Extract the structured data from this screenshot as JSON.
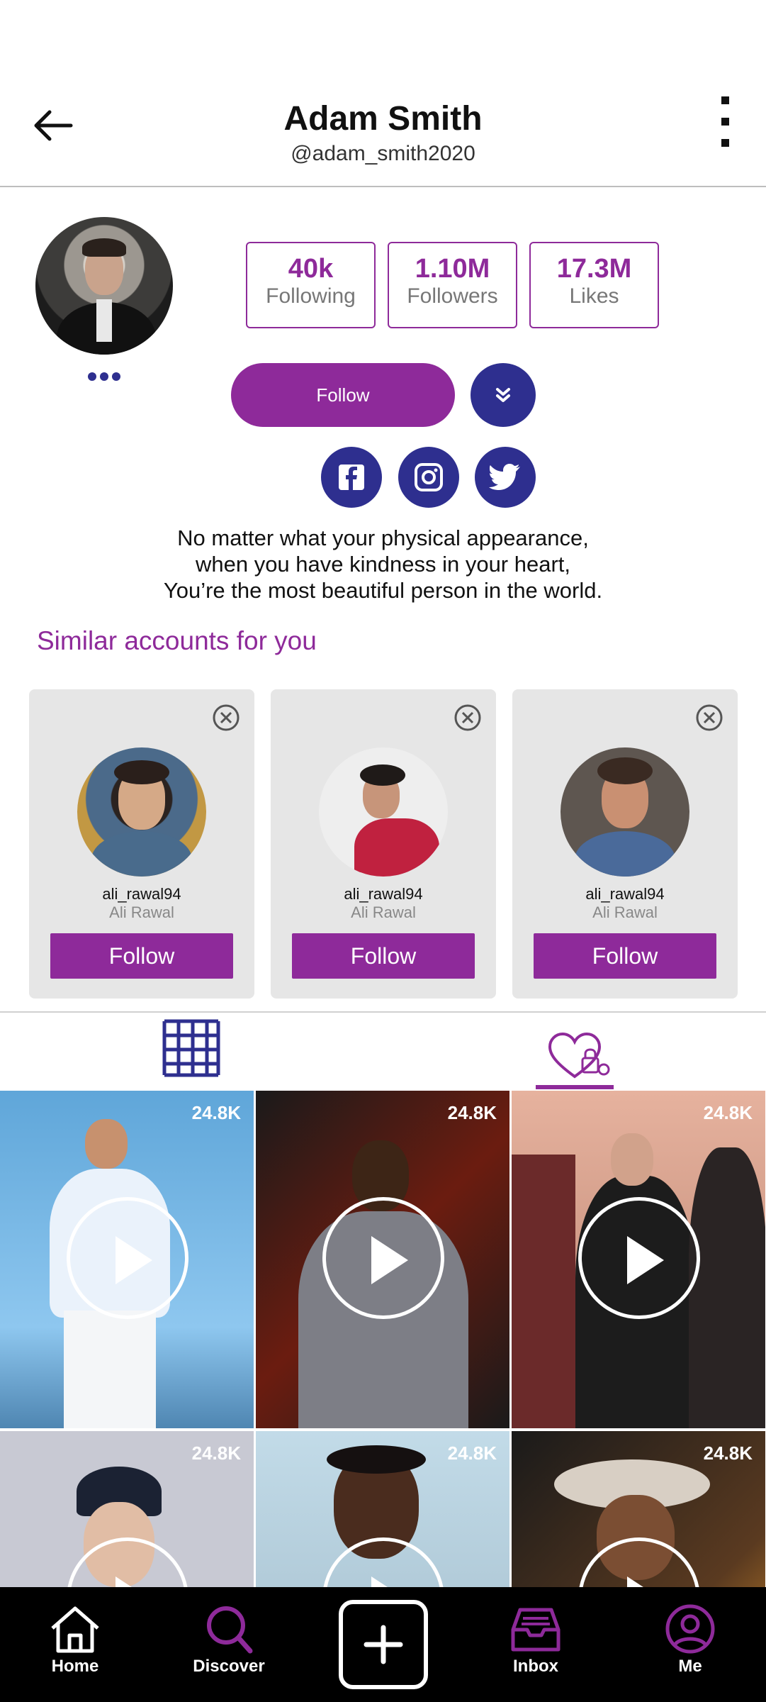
{
  "header": {
    "title": "Adam Smith",
    "handle": "@adam_smith2020"
  },
  "stats": [
    {
      "value": "40k",
      "label": "Following"
    },
    {
      "value": "1.10M",
      "label": "Followers"
    },
    {
      "value": "17.3M",
      "label": "Likes"
    }
  ],
  "actions": {
    "follow_label": "Follow"
  },
  "social": [
    "facebook-icon",
    "instagram-icon",
    "twitter-icon"
  ],
  "bio": [
    "No matter what your physical appearance,",
    "when you have kindness in your heart,",
    "You’re the most beautiful person in the world."
  ],
  "similar": {
    "title": "Similar accounts for you",
    "accounts": [
      {
        "username": "ali_rawal94",
        "name": "Ali Rawal",
        "follow_label": "Follow"
      },
      {
        "username": "ali_rawal94",
        "name": "Ali Rawal",
        "follow_label": "Follow"
      },
      {
        "username": "ali_rawal94",
        "name": "Ali Rawal",
        "follow_label": "Follow"
      }
    ]
  },
  "videos": [
    {
      "views": "24.8K"
    },
    {
      "views": "24.8K"
    },
    {
      "views": "24.8K"
    },
    {
      "views": "24.8K"
    },
    {
      "views": "24.8K"
    },
    {
      "views": "24.8K"
    }
  ],
  "nav": {
    "home": "Home",
    "discover": "Discover",
    "inbox": "Inbox",
    "me": "Me"
  },
  "colors": {
    "accent": "#8e2a9a",
    "navy": "#2e2f8f",
    "nav_bg": "#000000"
  }
}
